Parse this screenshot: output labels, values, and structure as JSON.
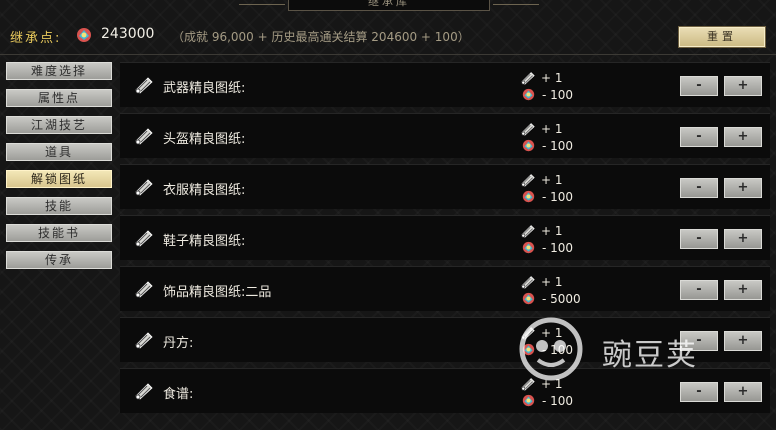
{
  "title": "继承库",
  "header": {
    "points_label": "继承点:",
    "points_icon": "gem-icon",
    "points_value": "243000",
    "points_detail": "（成就 96,000 + 历史最高通关结算 204600 + 100）",
    "reset_label": "重置"
  },
  "sidebar": {
    "items": [
      {
        "label": "难度选择",
        "active": false
      },
      {
        "label": "属性点",
        "active": false
      },
      {
        "label": "江湖技艺",
        "active": false
      },
      {
        "label": "道具",
        "active": false
      },
      {
        "label": "解锁图纸",
        "active": true
      },
      {
        "label": "技能",
        "active": false
      },
      {
        "label": "技能书",
        "active": false
      },
      {
        "label": "传承",
        "active": false
      }
    ]
  },
  "rows": [
    {
      "label": "武器精良图纸:",
      "gain": "+ 1",
      "cost": "- 100",
      "minus": "-",
      "plus": "+"
    },
    {
      "label": "头盔精良图纸:",
      "gain": "+ 1",
      "cost": "- 100",
      "minus": "-",
      "plus": "+"
    },
    {
      "label": "衣服精良图纸:",
      "gain": "+ 1",
      "cost": "- 100",
      "minus": "-",
      "plus": "+"
    },
    {
      "label": "鞋子精良图纸:",
      "gain": "+ 1",
      "cost": "- 100",
      "minus": "-",
      "plus": "+"
    },
    {
      "label": "饰品精良图纸:二品",
      "gain": "+ 1",
      "cost": "- 5000",
      "minus": "-",
      "plus": "+"
    },
    {
      "label": "丹方:",
      "gain": "+ 1",
      "cost": "- 100",
      "minus": "-",
      "plus": "+"
    },
    {
      "label": "食谱:",
      "gain": "+ 1",
      "cost": "- 100",
      "minus": "-",
      "plus": "+"
    }
  ],
  "icons": {
    "row_icon": "blueprint-scroll-icon",
    "gain_icon": "blueprint-scroll-icon",
    "cost_icon": "gem-icon"
  },
  "watermark": {
    "text": "豌豆荚",
    "logo": "wandoujia-logo"
  },
  "colors": {
    "accent_gold": "#e8c95c",
    "active_tab": "#f3e7b7",
    "row_bg": "#0b0b0b",
    "button_grey": "#c8c8c4"
  }
}
